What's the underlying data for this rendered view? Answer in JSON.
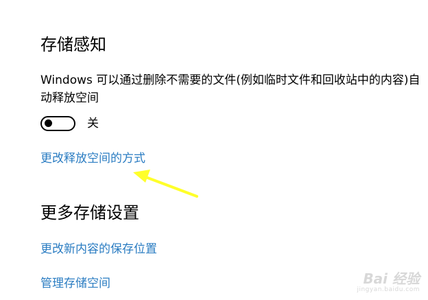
{
  "storage_sense": {
    "title": "存储感知",
    "description": "Windows 可以通过删除不需要的文件(例如临时文件和回收站中的内容)自动释放空间",
    "toggle_state_label": "关",
    "toggle_on": false,
    "change_free_up_link": "更改释放空间的方式"
  },
  "more_storage_settings": {
    "title": "更多存储设置",
    "change_save_location_link": "更改新内容的保存位置",
    "manage_storage_link": "管理存储空间"
  },
  "annotation": {
    "arrow_color": "#ffff2a"
  },
  "watermark": {
    "brand": "Bai 经验",
    "url": "jingyan.baidu.com"
  },
  "colors": {
    "link": "#2a7cc2",
    "text": "#000000",
    "background": "#ffffff"
  }
}
